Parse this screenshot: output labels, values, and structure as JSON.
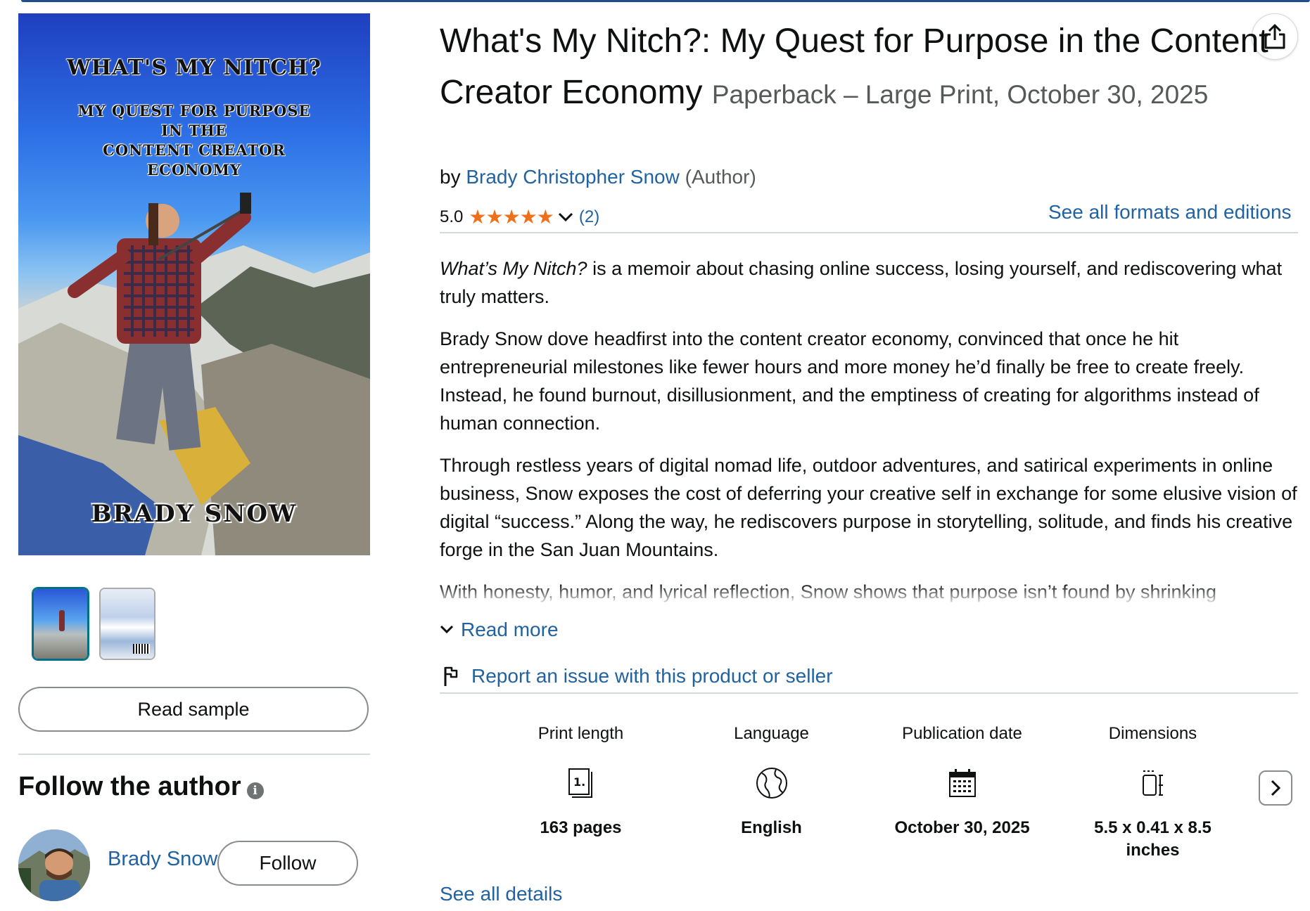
{
  "product": {
    "title": "What's My Nitch?: My Quest for Purpose in the Content Creator Economy",
    "edition": "Paperback – Large Print, October 30, 2025",
    "by_prefix": "by",
    "author": "Brady Christopher Snow",
    "author_role": "(Author)",
    "rating_value": "5.0",
    "stars": "★★★★★",
    "rating_count": "(2)",
    "formats_link": "See all formats and editions"
  },
  "cover": {
    "title_line": "WHAT'S MY NITCH?",
    "subtitle_lines": [
      "MY QUEST FOR PURPOSE",
      "IN THE",
      "CONTENT CREATOR",
      "ECONOMY"
    ],
    "author_line": "BRADY SNOW"
  },
  "description": {
    "p1_italic": "What’s My Nitch?",
    "p1_rest": " is a memoir about chasing online success, losing yourself, and rediscovering what truly matters.",
    "p2": "Brady Snow dove headfirst into the content creator economy, convinced that once he hit entrepreneurial milestones like fewer hours and more money he’d finally be free to create freely. Instead, he found burnout, disillusionment, and the emptiness of creating for algorithms instead of human connection.",
    "p3": "Through restless years of digital nomad life, outdoor adventures, and satirical experiments in online business, Snow exposes the cost of deferring your creative self in exchange for some elusive vision of digital “success.” Along the way, he rediscovers purpose in storytelling, solitude, and finds his creative forge in the San Juan Mountains.",
    "p4": "With honesty, humor, and lyrical reflection, Snow shows that purpose isn’t found by shrinking",
    "read_more": "Read more"
  },
  "report_link": "Report an issue with this product or seller",
  "left": {
    "read_sample": "Read sample",
    "follow_title": "Follow the author",
    "info_glyph": "i",
    "author_name": "Brady Snow",
    "follow_button": "Follow"
  },
  "details": [
    {
      "label": "Print length",
      "value": "163 pages",
      "icon": "book-pages-icon"
    },
    {
      "label": "Language",
      "value": "English",
      "icon": "globe-icon"
    },
    {
      "label": "Publication date",
      "value": "October 30, 2025",
      "icon": "calendar-icon"
    },
    {
      "label": "Dimensions",
      "value": "5.5 x 0.41 x 8.5 inches",
      "icon": "ruler-dimensions-icon"
    }
  ],
  "see_all_details": "See all details",
  "colors": {
    "link": "#2162a1",
    "star": "#f0701a",
    "text": "#0f1111",
    "muted": "#565959",
    "border": "#888c8c"
  }
}
